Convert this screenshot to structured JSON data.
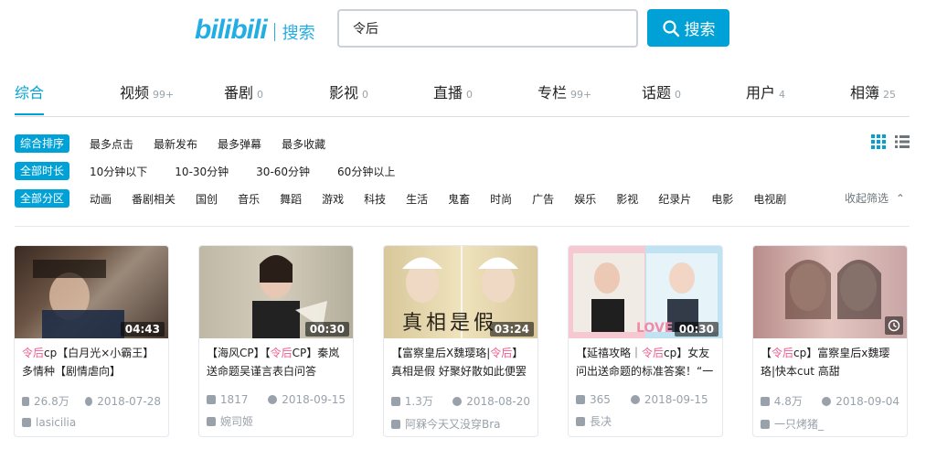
{
  "header": {
    "logo_text": "bilibili",
    "logo_sub": "搜索",
    "search_value": "令后",
    "search_button": "搜索"
  },
  "tabs": [
    {
      "label": "综合",
      "count": ""
    },
    {
      "label": "视频",
      "count": "99+"
    },
    {
      "label": "番剧",
      "count": "0"
    },
    {
      "label": "影视",
      "count": "0"
    },
    {
      "label": "直播",
      "count": "0"
    },
    {
      "label": "专栏",
      "count": "99+"
    },
    {
      "label": "话题",
      "count": "0"
    },
    {
      "label": "用户",
      "count": "4"
    },
    {
      "label": "相簿",
      "count": "25"
    }
  ],
  "filters": {
    "sort": {
      "pill": "综合排序",
      "options": [
        "最多点击",
        "最新发布",
        "最多弹幕",
        "最多收藏"
      ]
    },
    "duration": {
      "pill": "全部时长",
      "options": [
        "10分钟以下",
        "10-30分钟",
        "30-60分钟",
        "60分钟以上"
      ]
    },
    "zone": {
      "pill": "全部分区",
      "options": [
        "动画",
        "番剧相关",
        "国创",
        "音乐",
        "舞蹈",
        "游戏",
        "科技",
        "生活",
        "鬼畜",
        "时尚",
        "广告",
        "娱乐",
        "影视",
        "纪录片",
        "电影",
        "电视剧"
      ]
    },
    "collapse_label": "收起筛选"
  },
  "videos": [
    {
      "duration": "04:43",
      "title_pre": "",
      "title_hl": "令后",
      "title_post": "cp【白月光×小霸王】多情种【剧情虐向】",
      "views": "26.8万",
      "date": "2018-07-28",
      "uploader": "lasicilia",
      "thumb_text": ""
    },
    {
      "duration": "00:30",
      "title_pre": "【海风CP】【",
      "title_hl": "令后",
      "title_post": "CP】秦岚送命题吴谨言表白问答",
      "views": "1817",
      "date": "2018-09-15",
      "uploader": "婉司姬",
      "thumb_text": ""
    },
    {
      "duration": "03:24",
      "title_pre": "【富察皇后X魏璎珞|",
      "title_hl": "令后",
      "title_post": "】真相是假 好聚好散如此便罢",
      "views": "1.3万",
      "date": "2018-08-20",
      "uploader": "阿槑今天又没穿Bra",
      "thumb_text": "真相是假"
    },
    {
      "duration": "00:30",
      "title_pre": "【延禧攻略｜",
      "title_hl": "令后",
      "title_post": "cp】女友问出送命题的标准答案！“一",
      "views": "365",
      "date": "2018-09-15",
      "uploader": "長决",
      "thumb_text": "LOVE"
    },
    {
      "duration": "",
      "title_pre": "【",
      "title_hl": "令后",
      "title_post": "cp】富察皇后x魏璎珞|快本cut 高甜",
      "views": "4.8万",
      "date": "2018-09-04",
      "uploader": "一只烤猪_",
      "thumb_text": ""
    }
  ]
}
